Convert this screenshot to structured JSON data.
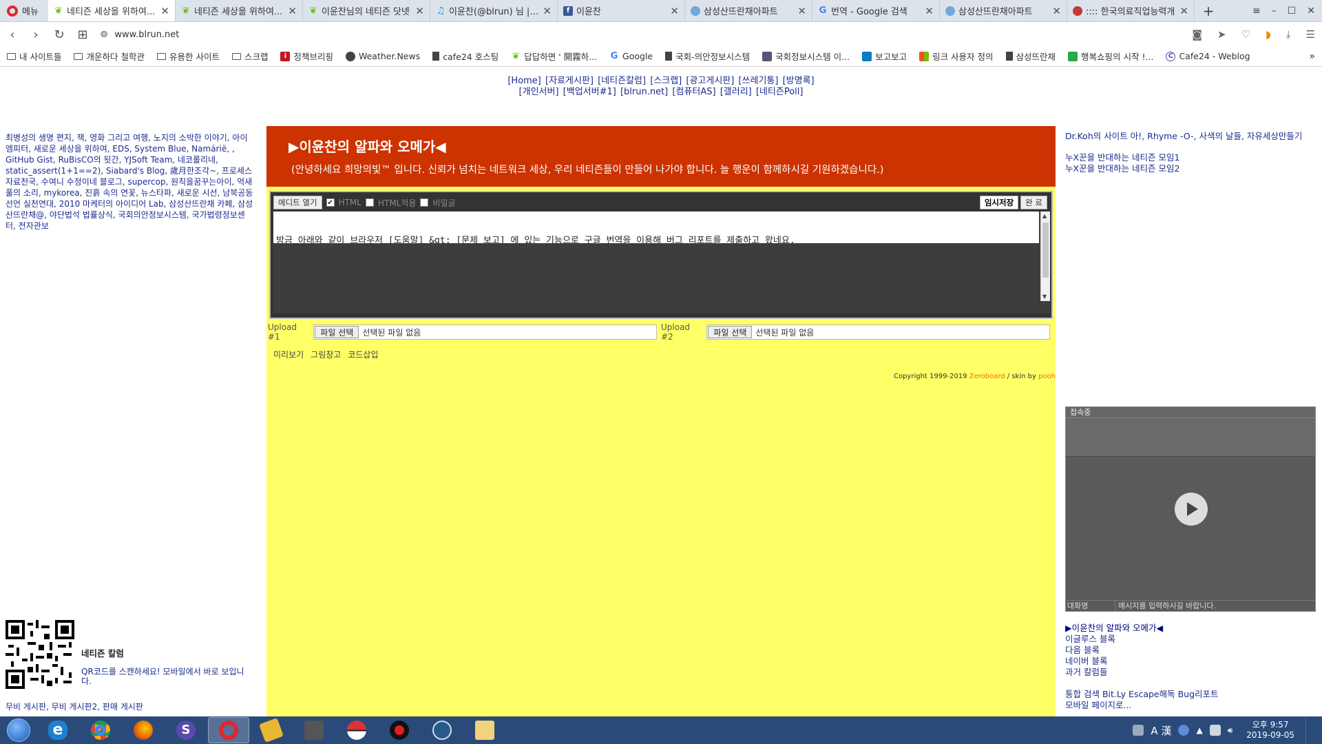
{
  "browser": {
    "menu_label": "메뉴",
    "tabs": [
      {
        "title": "네티즌 세상을 위하여...",
        "icon": "green-leaf-icon",
        "active": true
      },
      {
        "title": "네티즌 세상을 위하여...",
        "icon": "green-leaf-icon"
      },
      {
        "title": "이윤찬님의 네티즌 닷넷",
        "icon": "green-leaf-icon"
      },
      {
        "title": "이윤찬(@blrun) 님 | 트위",
        "icon": "twitter-icon"
      },
      {
        "title": "이윤찬",
        "icon": "facebook-icon"
      },
      {
        "title": "삼성산뜨란채아파트",
        "icon": "globe-icon"
      },
      {
        "title": "번역 - Google 검색",
        "icon": "google-icon"
      },
      {
        "title": "삼성산뜨란채아파트",
        "icon": "globe-icon"
      },
      {
        "title": ":::: 한국의료직업능력개",
        "icon": "site-icon"
      }
    ],
    "url": "www.blrun.net",
    "bookmarks": [
      {
        "label": "내 사이트들",
        "type": "folder"
      },
      {
        "label": "개운하다 철학관",
        "type": "folder"
      },
      {
        "label": "유용한 사이트",
        "type": "folder"
      },
      {
        "label": "스크랩",
        "type": "folder"
      },
      {
        "label": "정책브리핑",
        "type": "site"
      },
      {
        "label": "Weather.News",
        "type": "site"
      },
      {
        "label": "cafe24 호스팅",
        "type": "page"
      },
      {
        "label": "답답하면 ' 開霧하...",
        "type": "site"
      },
      {
        "label": "Google",
        "type": "site"
      },
      {
        "label": "국회-의안정보시스템",
        "type": "page"
      },
      {
        "label": "국회정보시스템 이...",
        "type": "site"
      },
      {
        "label": "보고보고",
        "type": "site"
      },
      {
        "label": "링크 사용자 정의",
        "type": "site"
      },
      {
        "label": "삼성뜨란채",
        "type": "page"
      },
      {
        "label": "행복쇼핑의 시작 !...",
        "type": "site"
      },
      {
        "label": "Cafe24 - Weblog",
        "type": "site"
      }
    ]
  },
  "topnav": {
    "row1": [
      "[Home]",
      "[자료게시판]",
      "[네티즌칼럼]",
      "[스크랩]",
      "[광고게시판]",
      "[쓰레기통]",
      "[방명록]"
    ],
    "row2": [
      "[개인서버]",
      "[백업서버#1]",
      "[blrun.net]",
      "[컴퓨터AS]",
      "[갤러리]",
      "[네티즌Poll]"
    ]
  },
  "left_links": "최병성의 생명 편지, 잭, 영화 그리고 여행, 노지의 소박한 이야기, 아이엠피터, 새로운 세상을 위하여, EDS, System Blue, Namárië, , GitHub Gist, RuBisCO의 됫간, YJSoft Team, 네코롤리네, static_assert(1+1==2), Siabard's Blog, 歲月한조각~, 프로세스 자료천국, 수여니 수정이네 블로그, supercop, 원칙을꿈꾸는아이, 억새풀의 소리, mykorea, 진흙 속의 연꽃, 뉴스타파, 새로운 시선, 남북공동선언 실천연대, 2010 마케터의 아이디어 Lab, 삼성산뜨란채 카페, 삼성산뜨란채@, 야단법석 법률상식, 국회의안정보시스템, 국가법령정보센터, 전자관보",
  "banner": {
    "title": "▶이윤찬의 알파와 오메가◀",
    "subtitle": "(안녕하세요 희망의빛™ 입니다. 신뢰가 넘치는 네트워크 세상, 우리 네티즌들이 만들어 나가야 합니다. 늘 행운이 함께하시길 기원하겠습니다.)"
  },
  "editor": {
    "open_editor": "에디트 열기",
    "html_label": "HTML",
    "html_apply_label": "HTML적용",
    "secret_label": "비밀글",
    "temp_save": "임시저장",
    "done": "완 료",
    "content_line1": "방금 아래와 같이 브라우저 [도움말] &gt; [문제 보고] 에 있는 기능으로 구글 번역을 이용해 버그 리포트를 제출하고 왔네요.",
    "content_line2": "=================================================================================================================",
    "html_checked": true,
    "html_apply_checked": false,
    "secret_checked": false
  },
  "uploads": [
    {
      "label": "Upload #1",
      "button": "파일 선택",
      "status": "선택된 파일 없음"
    },
    {
      "label": "Upload #2",
      "button": "파일 선택",
      "status": "선택된 파일 없음"
    }
  ],
  "tools": [
    "미리보기",
    "그림창고",
    "코드삽입"
  ],
  "copyright": {
    "prefix": "Copyright 1999-2019 ",
    "brand": "Zeroboard",
    "middle": " / skin by ",
    "skin": "pooh"
  },
  "qr": {
    "title": "네티즌 칼럼",
    "desc": "QR코드를 스캔하세요! 모바일에서 바로 보입니다."
  },
  "board_links": "무비 게시판, 무비 게시판2, 판매 게시판",
  "right_top": {
    "line1": "Dr.Koh의 사이트 아!, Rhyme -O-, 사색의 날들, 자유세상만들기",
    "line2": "누X꾼을 반대하는 네티즌 모임1",
    "line3": "누X꾼을 반대하는 네티즌 모임2"
  },
  "chat": {
    "header": "접속중",
    "name_label": "대화명",
    "msg_placeholder": "메시지를 입력하시길 바랍니다."
  },
  "right_bottom": {
    "links": [
      "▶이윤찬의 알파와 오메가◀",
      "이글루스 블록",
      "다음 블록",
      "네이버 블록",
      "과거 칼럼들"
    ],
    "links2": [
      "통합 검색 Bit.Ly Escape해독 Bug리포트",
      "모바일 페이지로..."
    ]
  },
  "taskbar": {
    "apps": [
      "ie-icon",
      "chrome-icon",
      "firefox-icon",
      "app-s-icon",
      "opera-icon",
      "winamp-icon",
      "book-icon",
      "pokeball-icon",
      "record-icon",
      "tree-icon",
      "folder-icon"
    ],
    "ime": "A 漢",
    "time": "오후 9:57",
    "date": "2019-09-05"
  },
  "colors": {
    "banner": "#cc3300",
    "main_bg": "#ffff66",
    "link": "#1a2c8c",
    "taskbar": "#2a4a7a"
  }
}
